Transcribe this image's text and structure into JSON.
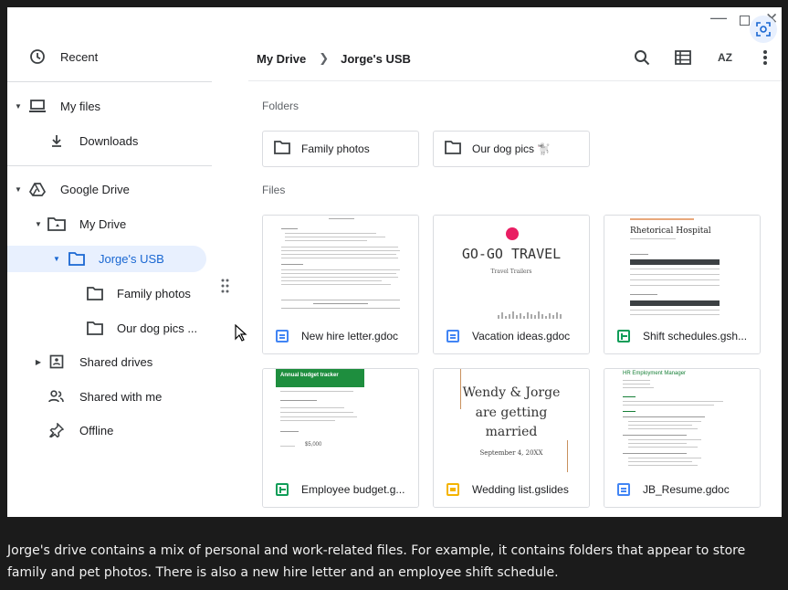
{
  "window": {
    "controls": {
      "minimize": "—",
      "close": "✕"
    }
  },
  "sidebar": {
    "recent": "Recent",
    "my_files": "My files",
    "downloads": "Downloads",
    "google_drive": "Google Drive",
    "my_drive": "My Drive",
    "jorges_usb": "Jorge's USB",
    "family_photos": "Family photos",
    "our_dog_pics": "Our dog pics ...",
    "shared_drives": "Shared drives",
    "shared_with_me": "Shared with me",
    "offline": "Offline"
  },
  "header": {
    "breadcrumb": [
      "My Drive",
      "Jorge's USB"
    ],
    "sort_label": "AZ"
  },
  "sections": {
    "folders": "Folders",
    "files": "Files"
  },
  "folders": [
    {
      "name": "Family photos"
    },
    {
      "name": "Our dog pics 🐩"
    }
  ],
  "files": [
    {
      "name": "New hire letter.gdoc",
      "type": "doc"
    },
    {
      "name": "Vacation ideas.gdoc",
      "type": "doc"
    },
    {
      "name": "Shift schedules.gsh...",
      "type": "sheet"
    },
    {
      "name": "Employee budget.g...",
      "type": "sheet"
    },
    {
      "name": "Wedding list.gslides",
      "type": "slides"
    },
    {
      "name": "JB_Resume.gdoc",
      "type": "doc"
    }
  ],
  "thumbnails": {
    "travel_title": "GO-GO TRAVEL",
    "travel_sub": "Travel Trailers",
    "hospital_title": "Rhetorical Hospital",
    "budget_title": "Annual budget tracker",
    "budget_amount": "$5,000",
    "wedding_line1": "Wendy & Jorge",
    "wedding_line2": "are getting",
    "wedding_line3": "married",
    "wedding_date": "September 4, 20XX",
    "resume_title": "HR Employment Manager"
  },
  "caption": "Jorge's drive contains a mix of personal and work-related files. For example, it contains folders that appear to store family and pet photos. There is also a new hire letter and an employee shift schedule.",
  "colors": {
    "accent": "#1967d2",
    "selected_bg": "#e8f0fe",
    "doc": "#4285f4",
    "sheet": "#0f9d58",
    "slides": "#f4b400"
  }
}
